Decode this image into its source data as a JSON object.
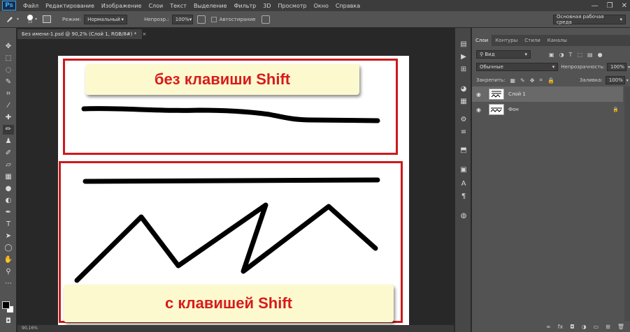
{
  "app": {
    "logo": "Ps"
  },
  "menu": [
    "Файл",
    "Редактирование",
    "Изображение",
    "Слои",
    "Текст",
    "Выделение",
    "Фильтр",
    "3D",
    "Просмотр",
    "Окно",
    "Справка"
  ],
  "window_controls": {
    "minimize": "—",
    "restore": "❐",
    "close": "✕"
  },
  "options": {
    "brush_size": "13",
    "mode_label": "Режим:",
    "mode_value": "Нормальный",
    "opacity_label": "Непрозр.:",
    "opacity_value": "100%",
    "smoothing_label": "Автостирание",
    "workspace": "Основная рабочая среда"
  },
  "document": {
    "tab_title": "Без имени-1.psd @ 90,2% (Слой 1, RGB/8#) *",
    "tab_close": "×",
    "caption_top": "без клавиши Shift",
    "caption_bottom": "с клавишей Shift",
    "zoom_status": "90,16%"
  },
  "panel": {
    "tabs": [
      "Слои",
      "Контуры",
      "Стили",
      "Каналы"
    ],
    "filter_label": "Вид",
    "blend_mode": "Обычные",
    "opacity_label": "Непрозрачность:",
    "opacity_value": "100%",
    "lock_label": "Закрепить:",
    "fill_label": "Заливка:",
    "fill_value": "100%",
    "layers": [
      {
        "name": "Слой 1",
        "selected": true,
        "locked": false
      },
      {
        "name": "Фон",
        "selected": false,
        "locked": true
      }
    ]
  },
  "colors": {
    "accent": "#cc1a1a",
    "caption_bg": "#fdf9cf",
    "caption_text": "#d81b1b"
  }
}
